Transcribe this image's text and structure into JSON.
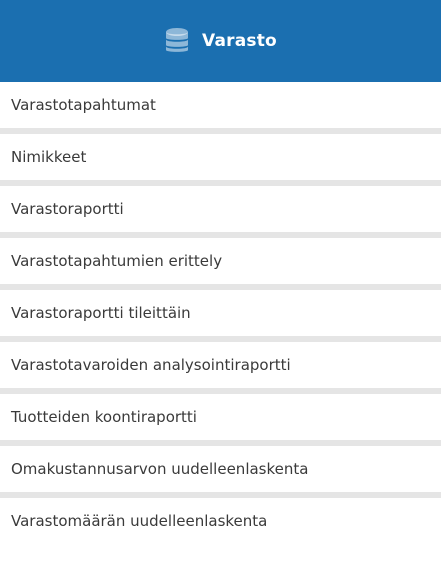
{
  "header": {
    "title": "Varasto",
    "icon": "database-icon",
    "background": "#1b6fb0"
  },
  "menu": {
    "items": [
      {
        "label": "Varastotapahtumat"
      },
      {
        "label": "Nimikkeet"
      },
      {
        "label": "Varastoraportti"
      },
      {
        "label": "Varastotapahtumien erittely"
      },
      {
        "label": "Varastoraportti tileittäin"
      },
      {
        "label": "Varastotavaroiden analysointiraportti"
      },
      {
        "label": "Tuotteiden koontiraportti"
      },
      {
        "label": "Omakustannusarvon uudelleenlaskenta"
      },
      {
        "label": "Varastomäärän uudelleenlaskenta"
      }
    ]
  }
}
